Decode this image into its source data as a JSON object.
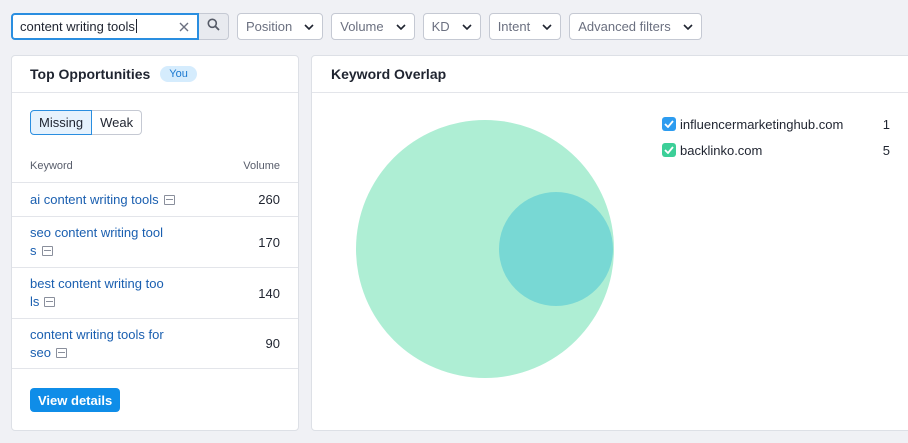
{
  "search": {
    "value": "content writing tools"
  },
  "filters": [
    {
      "label": "Position"
    },
    {
      "label": "Volume"
    },
    {
      "label": "KD"
    },
    {
      "label": "Intent"
    },
    {
      "label": "Advanced filters"
    }
  ],
  "top_opportunities": {
    "title": "Top Opportunities",
    "badge": "You",
    "tabs": {
      "missing": "Missing",
      "weak": "Weak",
      "active": "missing"
    },
    "columns": {
      "keyword": "Keyword",
      "volume": "Volume"
    },
    "rows": [
      {
        "keyword": "ai content writing tools",
        "volume": "260"
      },
      {
        "keyword": "seo content writing tools",
        "volume": "170"
      },
      {
        "keyword": "best content writing tools",
        "volume": "140"
      },
      {
        "keyword": "content writing tools for seo",
        "volume": "90"
      }
    ],
    "view_details": "View details"
  },
  "keyword_overlap": {
    "title": "Keyword Overlap",
    "domains": [
      {
        "name": "influencermarketinghub.com",
        "count": "1",
        "color": "#2d9cf0"
      },
      {
        "name": "backlinko.com",
        "count": "5",
        "color": "#3ccf98"
      }
    ],
    "circle_colors": {
      "large": "#aeeed4",
      "overlap": "#78d8d4"
    }
  }
}
